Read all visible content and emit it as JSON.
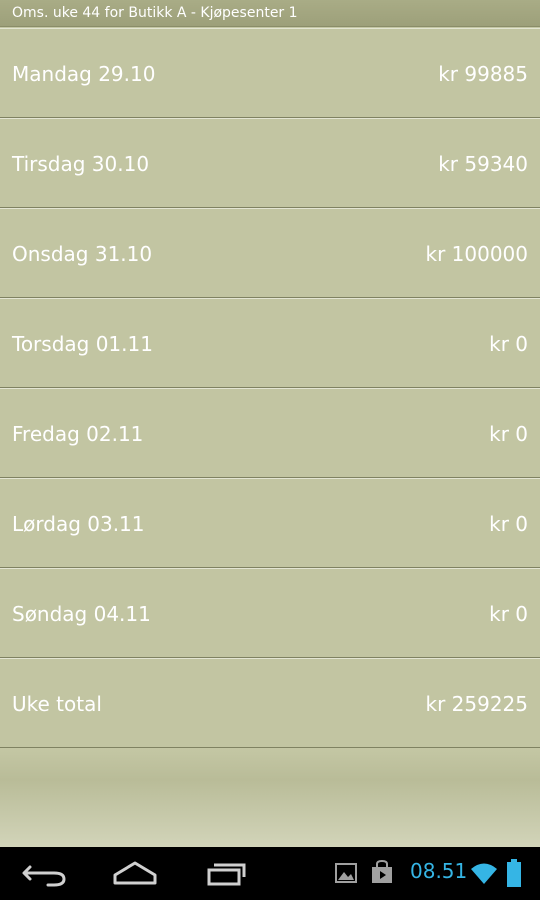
{
  "header": {
    "title": "Oms. uke 44 for Butikk A - Kjøpesenter 1"
  },
  "rows": [
    {
      "label": "Mandag 29.10",
      "amount": "kr 99885"
    },
    {
      "label": "Tirsdag 30.10",
      "amount": "kr 59340"
    },
    {
      "label": "Onsdag 31.10",
      "amount": "kr 100000"
    },
    {
      "label": "Torsdag 01.11",
      "amount": "kr 0"
    },
    {
      "label": "Fredag 02.11",
      "amount": "kr 0"
    },
    {
      "label": "Lørdag 03.11",
      "amount": "kr 0"
    },
    {
      "label": "Søndag 04.11",
      "amount": "kr 0"
    },
    {
      "label": "Uke total",
      "amount": "kr 259225"
    }
  ],
  "system_bar": {
    "time": "08.51",
    "icons": [
      "back-icon",
      "home-icon",
      "recent-apps-icon",
      "gallery-icon",
      "store-icon",
      "wifi-icon",
      "battery-icon"
    ],
    "accent_color": "#35b5e5"
  }
}
